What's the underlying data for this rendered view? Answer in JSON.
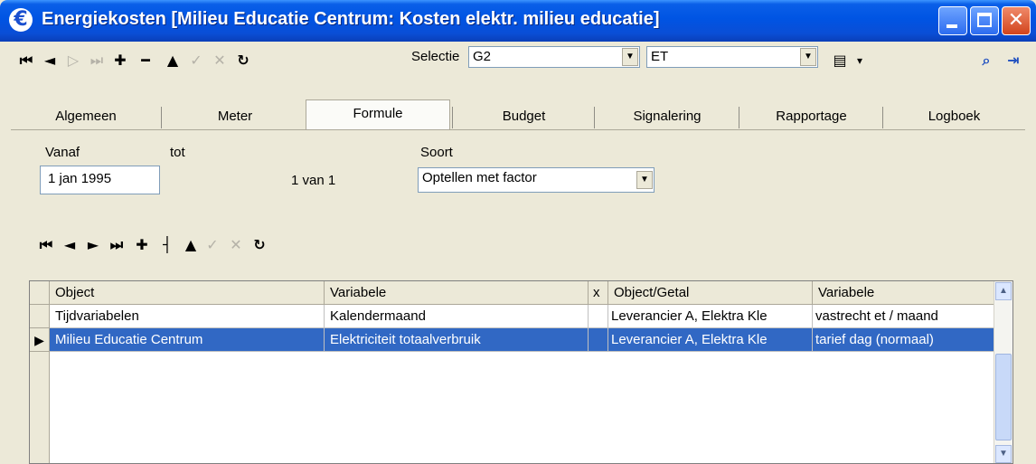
{
  "window": {
    "title": "Energiekosten [Milieu Educatie Centrum: Kosten elektr. milieu educatie]",
    "app_icon": "€",
    "minimize_icon": "minimize-icon",
    "maximize_icon": "maximize-icon",
    "close_icon": "close-icon"
  },
  "toolbar": {
    "first_glyph": "⏮",
    "prev_glyph": "◄",
    "next_glyph": "▷",
    "last_glyph": "⏭",
    "add_glyph": "✚",
    "delete_glyph": "━",
    "up_glyph": "▲",
    "confirm_glyph": "✓",
    "cancel_glyph": "✕",
    "refresh_glyph": "↻",
    "selectie_label": "Selectie",
    "selectie_value": "G2",
    "second_value": "ET",
    "report_glyph": "▤",
    "report_drop": "▾",
    "preview_glyph": "⌕",
    "exit_glyph": "⇥"
  },
  "tabs": [
    {
      "label": "Algemeen"
    },
    {
      "label": "Meter"
    },
    {
      "label": "Formule",
      "active": true
    },
    {
      "label": "Budget"
    },
    {
      "label": "Signalering"
    },
    {
      "label": "Rapportage"
    },
    {
      "label": "Logboek"
    }
  ],
  "form": {
    "vanaf_label": "Vanaf",
    "tot_label": "tot",
    "soort_label": "Soort",
    "vanaf_value": "1 jan 1995",
    "record_count": "1 van 1",
    "soort_value": "Optellen met factor"
  },
  "subnav": {
    "first_glyph": "⏮",
    "prev_glyph": "◄",
    "next_glyph": "►",
    "last_glyph": "⏭",
    "add_glyph": "✚",
    "split_glyph": "┤",
    "up_glyph": "▲",
    "confirm_glyph": "✓",
    "cancel_glyph": "✕",
    "refresh_glyph": "↻"
  },
  "grid": {
    "headers": [
      "Object",
      "Variabele",
      "x",
      "Object/Getal",
      "Variabele"
    ],
    "rows": [
      [
        "Tijdvariabelen",
        "Kalendermaand",
        "",
        "Leverancier A, Elektra Kle",
        "vastrecht et / maand"
      ],
      [
        "Milieu Educatie Centrum",
        "Elektriciteit totaalverbruik",
        "",
        "Leverancier A, Elektra Kle",
        "tarief dag (normaal)"
      ]
    ],
    "selected_row_marker": "▶",
    "scroll_up": "▲",
    "scroll_down": "▼"
  },
  "colors": {
    "titlebar": "#0054e3",
    "selection": "#3168c4",
    "window_bg": "#ece9d8"
  }
}
